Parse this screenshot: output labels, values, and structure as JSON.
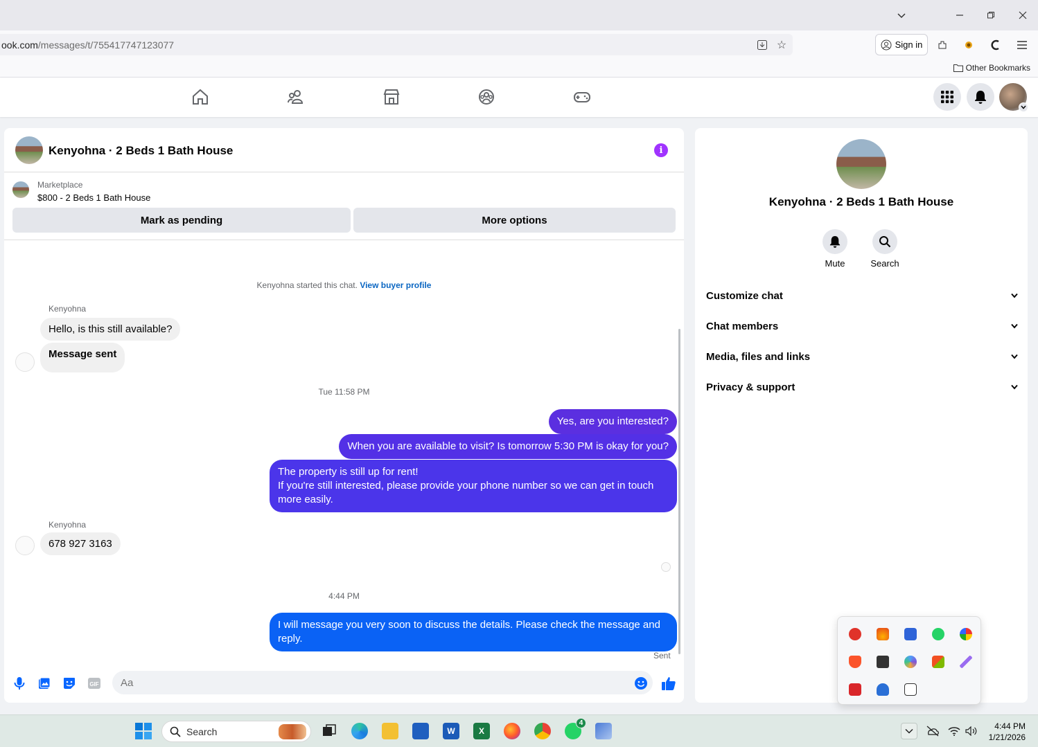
{
  "browser": {
    "url_host": "ook.com",
    "url_path": "/messages/t/755417747123077",
    "signin_label": "Sign in",
    "bookmark_folder": "Other Bookmarks"
  },
  "chat": {
    "title": "Kenyohna · 2 Beds 1 Bath House",
    "marketplace_label": "Marketplace",
    "listing": "$800 - 2 Beds 1 Bath House",
    "mark_pending": "Mark as pending",
    "more_options": "More options",
    "started_text": "Kenyohna started this chat.",
    "view_buyer": "View buyer profile",
    "messages": {
      "sender1": "Kenyohna",
      "in1": "Hello, is this still available?",
      "in2": "Message sent",
      "ts1": "Tue 11:58 PM",
      "out1": "Yes, are you interested?",
      "out2": "When you are available to visit? Is tomorrow 5:30 PM is okay for you?",
      "out3_line1": "The property is still up for rent!",
      "out3_line2": "If you're still interested, please provide your phone number so we can get in touch more easily.",
      "sender2": "Kenyohna",
      "in3": "678 927 3163",
      "ts2": "4:44 PM",
      "out4": "I will message you very soon to discuss the details. Please check the message and reply.",
      "status": "Sent"
    },
    "composer_placeholder": "Aa",
    "colors": {
      "outgoing_purple": "#5b2fe0",
      "outgoing_blue": "#0a62f5",
      "link": "#0a66c2"
    }
  },
  "info_panel": {
    "name": "Kenyohna · 2 Beds 1 Bath House",
    "mute": "Mute",
    "search": "Search",
    "sections": [
      "Customize chat",
      "Chat members",
      "Media, files and links",
      "Privacy & support"
    ]
  },
  "taskbar": {
    "search_label": "Search",
    "whatsapp_badge": "4",
    "time": "4:44 PM",
    "date": "1/21/2026"
  }
}
